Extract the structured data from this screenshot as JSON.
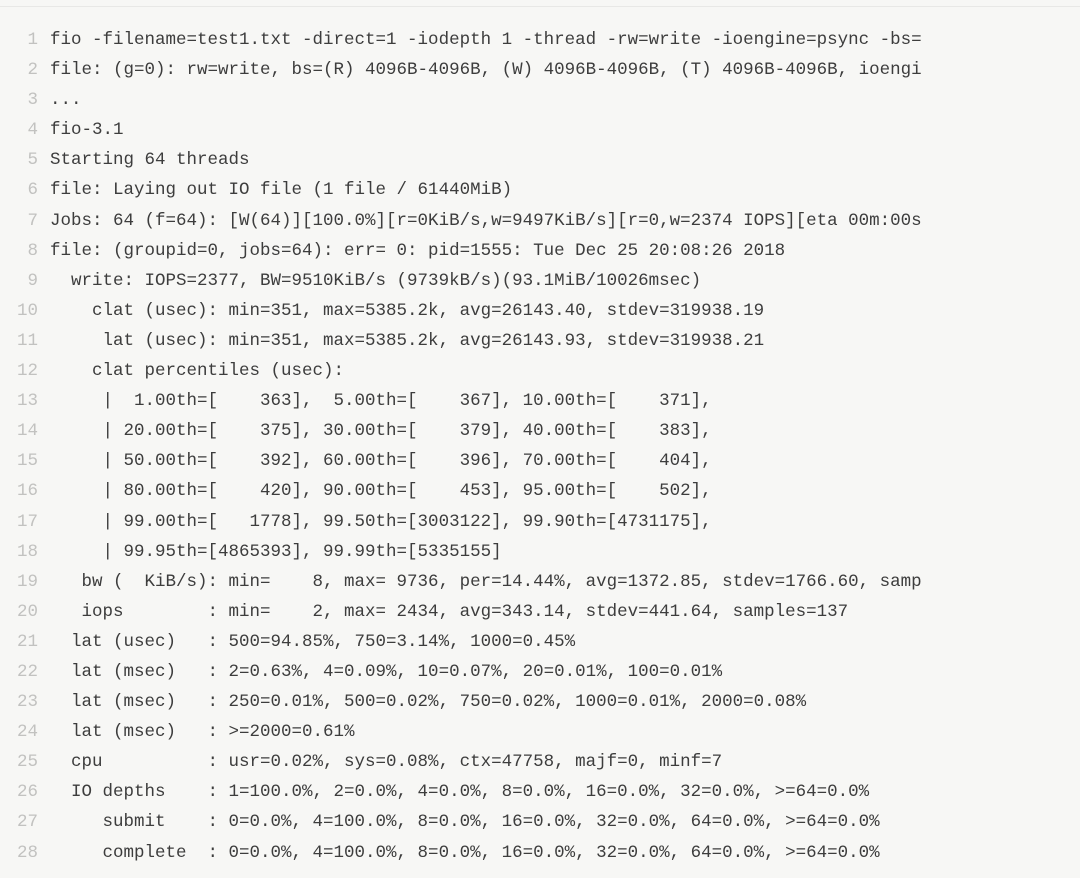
{
  "code": {
    "lines": [
      "fio -filename=test1.txt -direct=1 -iodepth 1 -thread -rw=write -ioengine=psync -bs=",
      "file: (g=0): rw=write, bs=(R) 4096B-4096B, (W) 4096B-4096B, (T) 4096B-4096B, ioengi",
      "...",
      "fio-3.1",
      "Starting 64 threads",
      "file: Laying out IO file (1 file / 61440MiB)",
      "Jobs: 64 (f=64): [W(64)][100.0%][r=0KiB/s,w=9497KiB/s][r=0,w=2374 IOPS][eta 00m:00s",
      "file: (groupid=0, jobs=64): err= 0: pid=1555: Tue Dec 25 20:08:26 2018",
      "  write: IOPS=2377, BW=9510KiB/s (9739kB/s)(93.1MiB/10026msec)",
      "    clat (usec): min=351, max=5385.2k, avg=26143.40, stdev=319938.19",
      "     lat (usec): min=351, max=5385.2k, avg=26143.93, stdev=319938.21",
      "    clat percentiles (usec):",
      "     |  1.00th=[    363],  5.00th=[    367], 10.00th=[    371],",
      "     | 20.00th=[    375], 30.00th=[    379], 40.00th=[    383],",
      "     | 50.00th=[    392], 60.00th=[    396], 70.00th=[    404],",
      "     | 80.00th=[    420], 90.00th=[    453], 95.00th=[    502],",
      "     | 99.00th=[   1778], 99.50th=[3003122], 99.90th=[4731175],",
      "     | 99.95th=[4865393], 99.99th=[5335155]",
      "   bw (  KiB/s): min=    8, max= 9736, per=14.44%, avg=1372.85, stdev=1766.60, samp",
      "   iops        : min=    2, max= 2434, avg=343.14, stdev=441.64, samples=137",
      "  lat (usec)   : 500=94.85%, 750=3.14%, 1000=0.45%",
      "  lat (msec)   : 2=0.63%, 4=0.09%, 10=0.07%, 20=0.01%, 100=0.01%",
      "  lat (msec)   : 250=0.01%, 500=0.02%, 750=0.02%, 1000=0.01%, 2000=0.08%",
      "  lat (msec)   : >=2000=0.61%",
      "  cpu          : usr=0.02%, sys=0.08%, ctx=47758, majf=0, minf=7",
      "  IO depths    : 1=100.0%, 2=0.0%, 4=0.0%, 8=0.0%, 16=0.0%, 32=0.0%, >=64=0.0%",
      "     submit    : 0=0.0%, 4=100.0%, 8=0.0%, 16=0.0%, 32=0.0%, 64=0.0%, >=64=0.0%",
      "     complete  : 0=0.0%, 4=100.0%, 8=0.0%, 16=0.0%, 32=0.0%, 64=0.0%, >=64=0.0%"
    ]
  }
}
